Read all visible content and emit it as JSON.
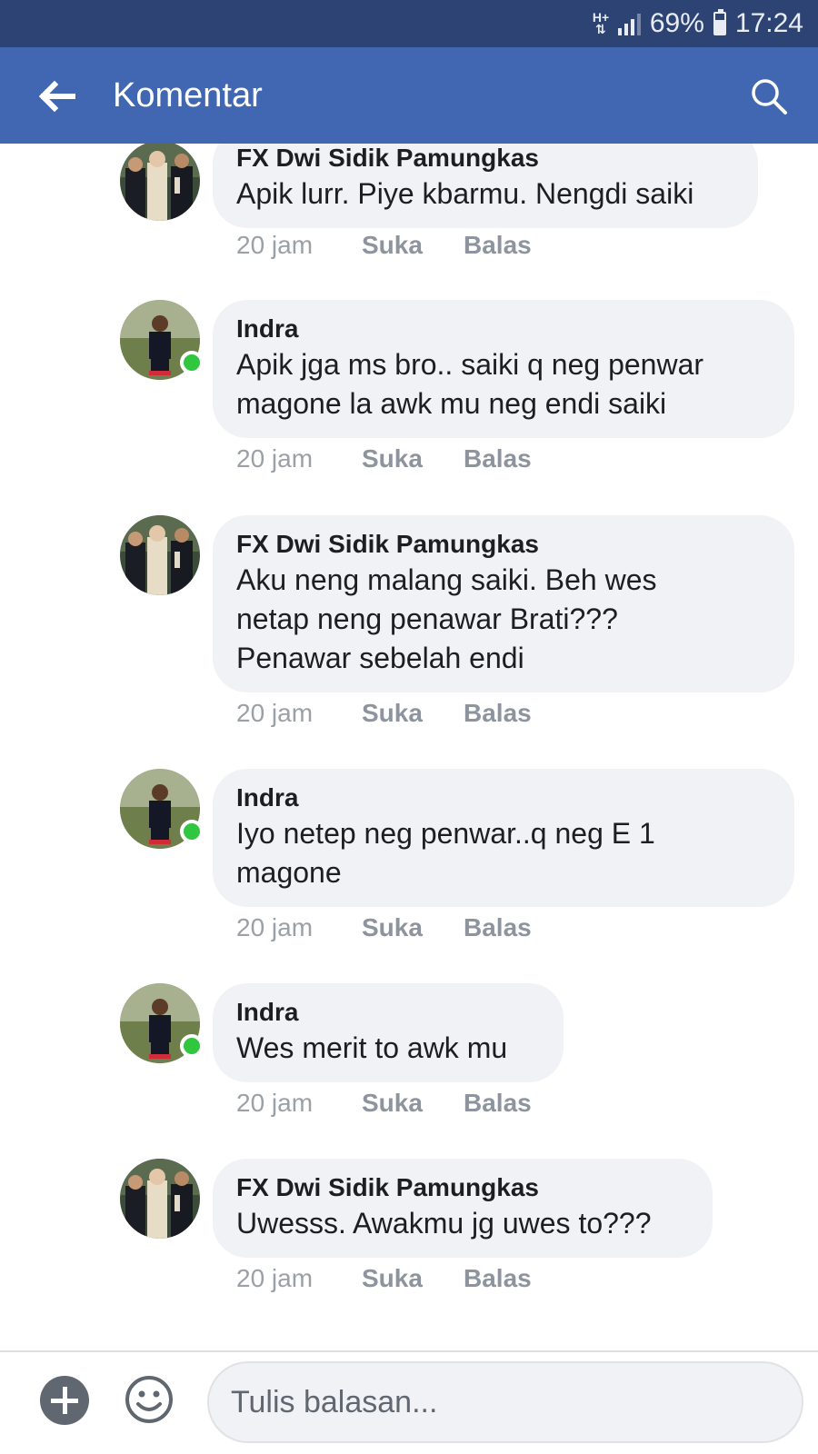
{
  "status_bar": {
    "network": "H+",
    "battery": "69%",
    "battery_level": 0.69,
    "time": "17:24",
    "icons": [
      "network-type-icon",
      "signal-icon",
      "battery-icon"
    ]
  },
  "header": {
    "title": "Komentar",
    "back_icon": "arrow-left-icon",
    "search_icon": "search-icon"
  },
  "comments": [
    {
      "author": "FX Dwi Sidik Pamungkas",
      "lines": [
        "Apik lurr.  Piye kbarmu.  Nengdi saiki"
      ],
      "online": false,
      "time": "20 jam",
      "like": "Suka",
      "reply": "Balas"
    },
    {
      "author": "Indra",
      "lines": [
        "Apik jga ms bro.. saiki q neg penwar",
        "magone la awk mu neg endi saiki"
      ],
      "online": true,
      "time": "20 jam",
      "like": "Suka",
      "reply": "Balas"
    },
    {
      "author": "FX Dwi Sidik Pamungkas",
      "lines": [
        "Aku neng malang saiki.  Beh wes",
        "netap neng penawar Brati???",
        "Penawar sebelah endi"
      ],
      "online": false,
      "time": "20 jam",
      "like": "Suka",
      "reply": "Balas"
    },
    {
      "author": "Indra",
      "lines": [
        "Iyo netep neg penwar..q neg E 1",
        "magone"
      ],
      "online": true,
      "time": "20 jam",
      "like": "Suka",
      "reply": "Balas"
    },
    {
      "author": "Indra",
      "lines": [
        "Wes merit to awk mu"
      ],
      "online": true,
      "time": "20 jam",
      "like": "Suka",
      "reply": "Balas"
    },
    {
      "author": "FX Dwi Sidik Pamungkas",
      "lines": [
        "Uwesss. Awakmu jg uwes to???"
      ],
      "online": false,
      "time": "20 jam",
      "like": "Suka",
      "reply": "Balas"
    }
  ],
  "composer": {
    "placeholder": "Tulis balasan...",
    "add_icon": "plus-circle-icon",
    "emoji_icon": "emoji-smile-icon"
  },
  "colors": {
    "header": "#4267b2",
    "status_bar": "#2d4373",
    "bubble": "#f0f2f5",
    "online": "#31c63f",
    "meta_text": "#8d949e"
  }
}
